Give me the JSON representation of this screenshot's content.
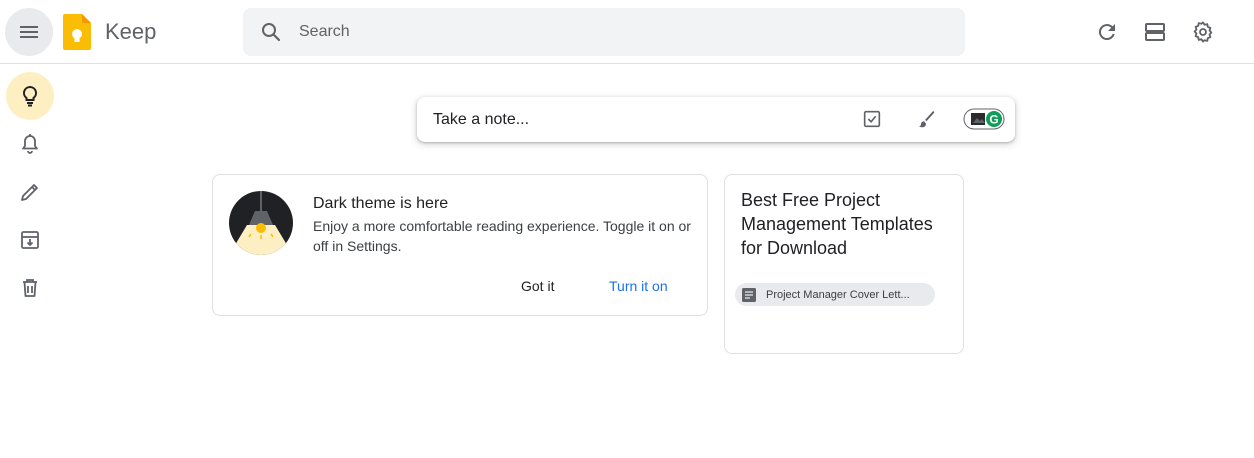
{
  "header": {
    "app_title": "Keep",
    "search_placeholder": "Search",
    "icons": [
      "menu-icon",
      "keep-logo",
      "search-icon",
      "refresh-icon",
      "list-view-icon",
      "settings-icon"
    ]
  },
  "sidebar": {
    "items": [
      {
        "name": "notes",
        "icon": "lightbulb-icon",
        "active": true
      },
      {
        "name": "reminders",
        "icon": "bell-icon",
        "active": false
      },
      {
        "name": "edit-labels",
        "icon": "pencil-icon",
        "active": false
      },
      {
        "name": "archive",
        "icon": "archive-icon",
        "active": false
      },
      {
        "name": "trash",
        "icon": "trash-icon",
        "active": false
      }
    ]
  },
  "take_note": {
    "placeholder": "Take a note..."
  },
  "dark_theme_card": {
    "title": "Dark theme is here",
    "body": "Enjoy a more comfortable reading experience. Toggle it on or off in Settings.",
    "got_it": "Got it",
    "turn_on": "Turn it on"
  },
  "note_card": {
    "title": "Best Free Project Management Templates for Download",
    "chip": "Project Manager Cover Lett..."
  },
  "colors": {
    "active_bg": "#feefc3",
    "accent_blue": "#1a73e8",
    "keep_yellow": "#fbbc04",
    "search_bg": "#f1f3f4"
  }
}
